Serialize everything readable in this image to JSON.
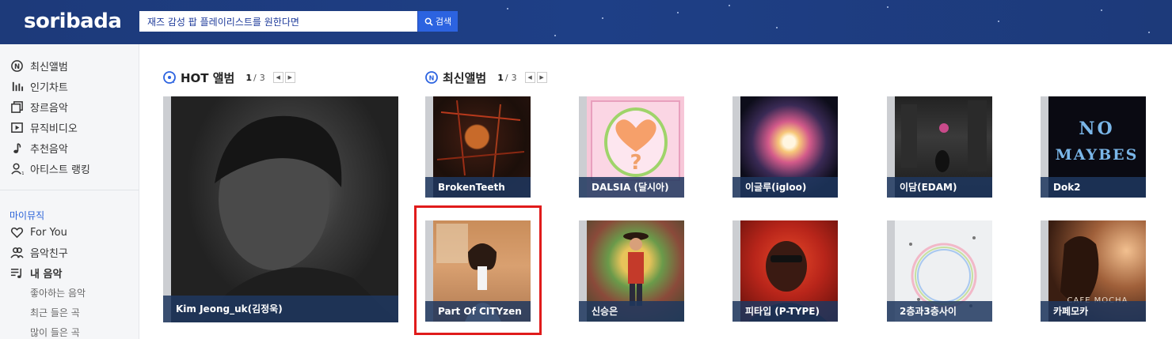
{
  "header": {
    "logo": "soribada",
    "search_value": "재즈 감성 팝 플레이리스트를 원한다면",
    "search_button": "검색"
  },
  "sidebar": {
    "items": [
      {
        "label": "최신앨범",
        "icon": "new-album-icon"
      },
      {
        "label": "인기차트",
        "icon": "chart-bars-icon"
      },
      {
        "label": "장르음악",
        "icon": "genre-squares-icon"
      },
      {
        "label": "뮤직비디오",
        "icon": "video-play-icon"
      },
      {
        "label": "추천음악",
        "icon": "music-note-icon"
      },
      {
        "label": "아티스트 랭킹",
        "icon": "artist-rank-icon"
      }
    ],
    "my_music_label": "마이뮤직",
    "my_items": [
      {
        "label": "For You",
        "icon": "heart-icon"
      },
      {
        "label": "음악친구",
        "icon": "friends-icon"
      },
      {
        "label": "내 음악",
        "icon": "playlist-icon"
      }
    ],
    "sub_items": [
      "좋아하는 음악",
      "최근 들은 곡",
      "많이 들은 곡"
    ]
  },
  "hot_album": {
    "title": "HOT 앨범",
    "page": "1",
    "total": "3",
    "album": {
      "artist": "Kim Jeong_uk(김정욱)"
    }
  },
  "new_albums": {
    "title": "최신앨범",
    "page": "1",
    "total": "3",
    "albums": [
      {
        "artist": "BrokenTeeth"
      },
      {
        "artist": "DALSIA (달시아)"
      },
      {
        "artist": "이글루(igloo)"
      },
      {
        "artist": "이담(EDAM)"
      },
      {
        "artist": "Dok2"
      },
      {
        "artist": "Part Of CITYzen",
        "highlighted": true
      },
      {
        "artist": "신승은"
      },
      {
        "artist": "피타입 (P-TYPE)"
      },
      {
        "artist": "2층과3층사이"
      },
      {
        "artist": "카페모카"
      }
    ]
  },
  "colors": {
    "header_bg": "#1d3a7a",
    "accent": "#2c63e0",
    "caption_bg": "#1e375f",
    "highlight_border": "#e01b1b"
  }
}
